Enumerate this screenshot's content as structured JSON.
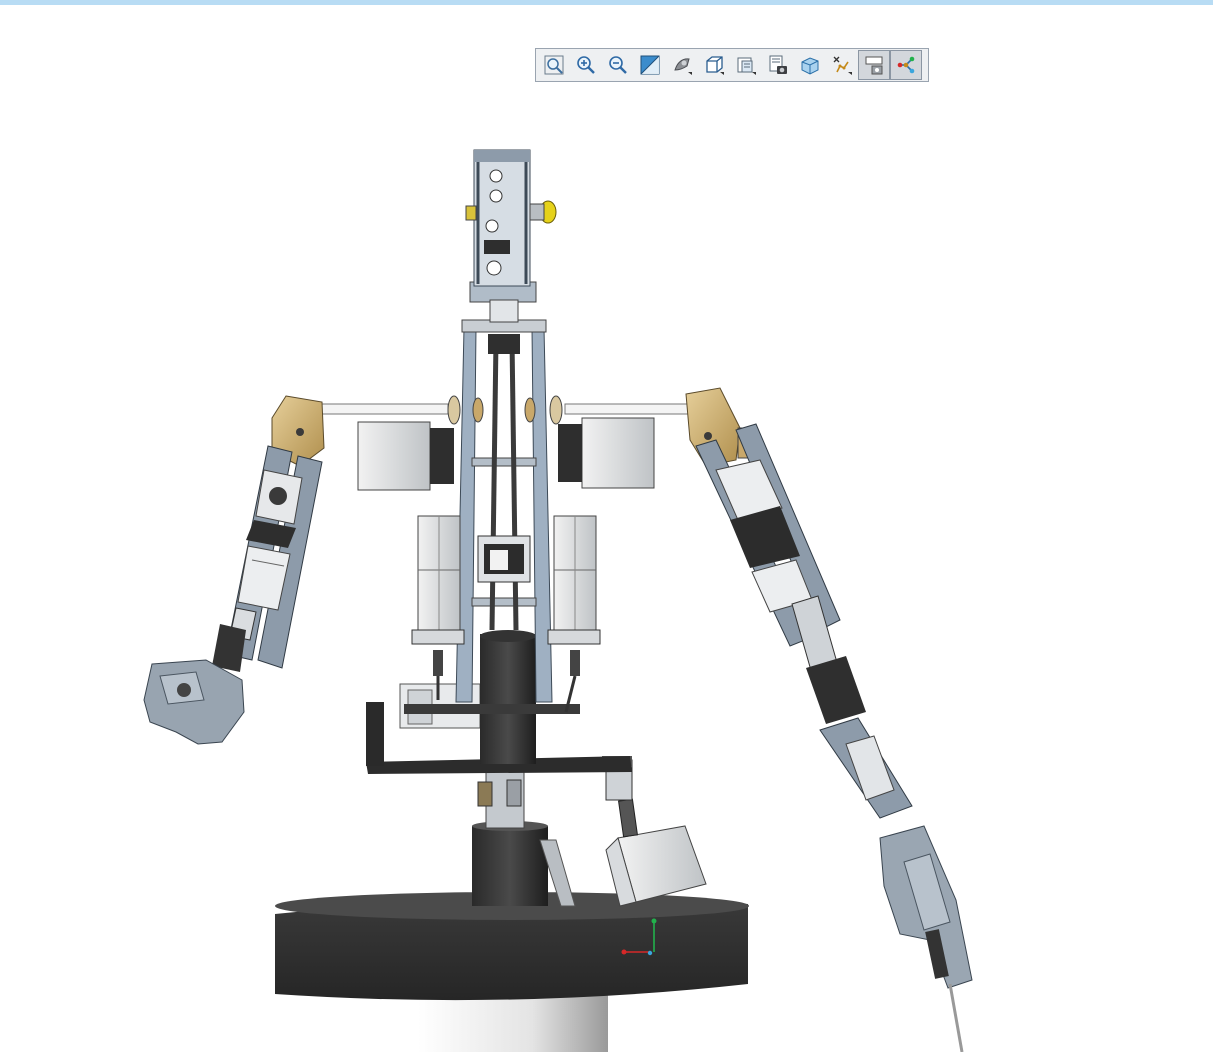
{
  "app": {
    "accent_color": "#b8dcf4",
    "toolbar_background": "#eef0f2"
  },
  "view_toolbar": {
    "tools": [
      {
        "icon": "fit-all-icon",
        "active": false
      },
      {
        "icon": "zoom-in-icon",
        "active": false
      },
      {
        "icon": "zoom-out-icon",
        "active": false
      },
      {
        "icon": "normal-view-icon",
        "active": false
      },
      {
        "icon": "shading-icon",
        "active": false
      },
      {
        "icon": "view-mode-icon",
        "active": false
      },
      {
        "icon": "named-views-icon",
        "active": false
      },
      {
        "icon": "capture-icon",
        "active": false
      },
      {
        "icon": "cube-view-icon",
        "active": false
      },
      {
        "icon": "explode-icon",
        "active": false
      },
      {
        "icon": "hide-show-icon",
        "active": true
      },
      {
        "icon": "branch-tree-icon",
        "active": true
      }
    ]
  },
  "viewport": {
    "model": "humanoid-robot-assembly",
    "axis_colors": {
      "x": "#d62828",
      "y": "#22b14c",
      "z": "#3aa6dd"
    }
  }
}
